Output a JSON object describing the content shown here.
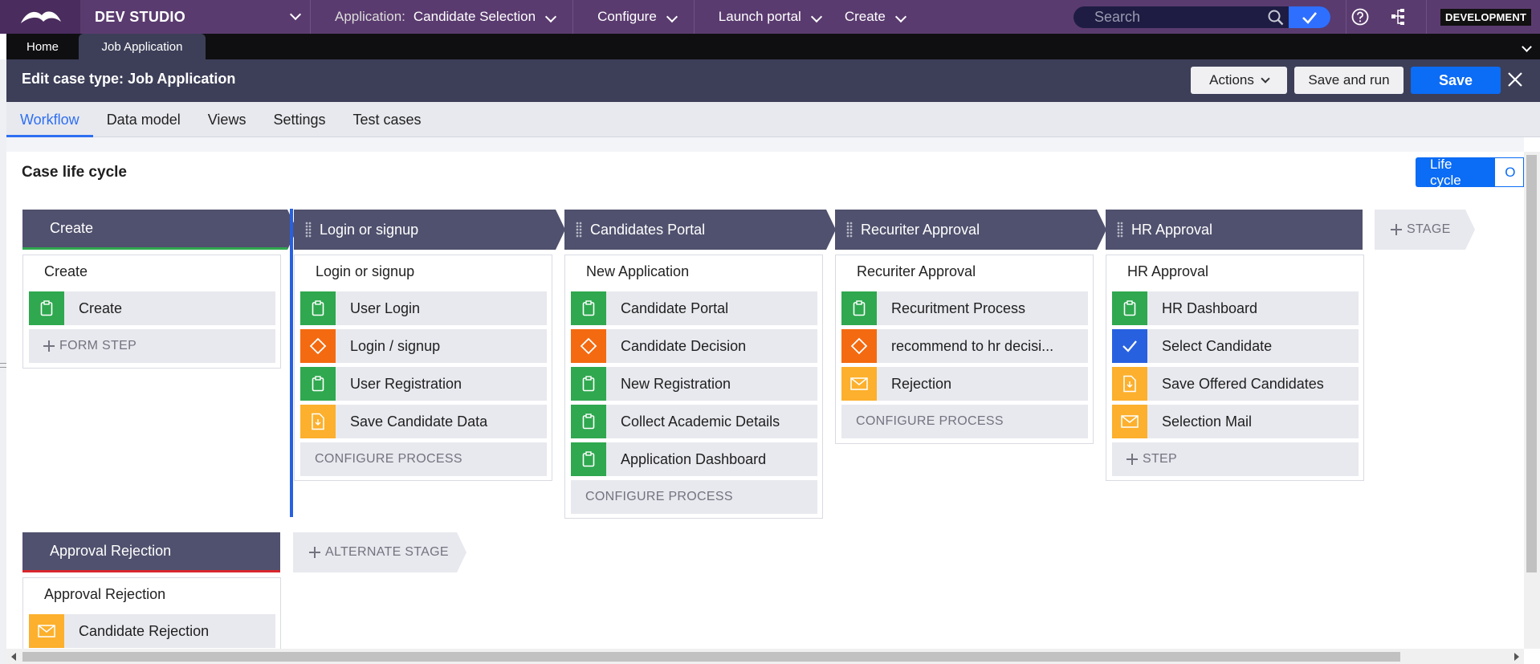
{
  "topbar": {
    "brand": "DEV STUDIO",
    "application_label": "Application:",
    "application_value": "Candidate Selection",
    "configure": "Configure",
    "launch_portal": "Launch portal",
    "create": "Create",
    "search_placeholder": "Search",
    "environment": "DEVELOPMENT",
    "icons": [
      "pega-logo-icon",
      "chevron-down-icon",
      "search-icon",
      "check-icon",
      "help-icon",
      "sitemap-icon"
    ]
  },
  "doc_tabs": [
    {
      "label": "Home",
      "active": false
    },
    {
      "label": "Job Application",
      "active": true
    }
  ],
  "case_header": {
    "prefix": "Edit case type:",
    "name": "Job Application",
    "actions_label": "Actions",
    "save_and_run_label": "Save and run",
    "save_label": "Save"
  },
  "sub_tabs": [
    {
      "label": "Workflow",
      "active": true
    },
    {
      "label": "Data model",
      "active": false
    },
    {
      "label": "Views",
      "active": false
    },
    {
      "label": "Settings",
      "active": false
    },
    {
      "label": "Test cases",
      "active": false
    }
  ],
  "section_title": "Case life cycle",
  "view_toggle": {
    "active": "Life cycle",
    "other": "O"
  },
  "stages": [
    {
      "name": "Create",
      "process": "Create",
      "steps": [
        {
          "type": "form",
          "label": "Create"
        }
      ],
      "add_label": "FORM STEP"
    },
    {
      "name": "Login or signup",
      "process": "Login or signup",
      "steps": [
        {
          "type": "form",
          "label": "User Login"
        },
        {
          "type": "decision",
          "label": "Login / signup"
        },
        {
          "type": "form",
          "label": "User Registration"
        },
        {
          "type": "save",
          "label": "Save Candidate Data"
        }
      ],
      "add_label": "CONFIGURE PROCESS"
    },
    {
      "name": "Candidates Portal",
      "process": "New Application",
      "steps": [
        {
          "type": "form",
          "label": "Candidate Portal"
        },
        {
          "type": "decision",
          "label": "Candidate Decision"
        },
        {
          "type": "form",
          "label": "New Registration"
        },
        {
          "type": "form",
          "label": "Collect Academic Details"
        },
        {
          "type": "form",
          "label": "Application Dashboard"
        }
      ],
      "add_label": "CONFIGURE PROCESS"
    },
    {
      "name": "Recuriter Approval",
      "process": "Recuriter Approval",
      "steps": [
        {
          "type": "form",
          "label": "Recuritment Process"
        },
        {
          "type": "decision",
          "label": "recommend to hr decisi..."
        },
        {
          "type": "email",
          "label": "Rejection"
        }
      ],
      "add_label": "CONFIGURE PROCESS"
    },
    {
      "name": "HR Approval",
      "process": "HR Approval",
      "steps": [
        {
          "type": "form",
          "label": "HR Dashboard"
        },
        {
          "type": "approval",
          "label": "Select Candidate"
        },
        {
          "type": "save",
          "label": "Save Offered Candidates"
        },
        {
          "type": "email",
          "label": "Selection Mail"
        }
      ],
      "add_label": "STEP"
    }
  ],
  "add_stage_label": "STAGE",
  "alternate_stage": {
    "name": "Approval Rejection",
    "process": "Approval Rejection",
    "steps": [
      {
        "type": "email",
        "label": "Candidate Rejection"
      }
    ]
  },
  "add_alternate_stage_label": "ALTERNATE STAGE",
  "colors": {
    "topbar": "#5a3b6f",
    "header": "#3d3f58",
    "stage": "#50516e",
    "primary": "#0b6cf5",
    "form_step": "#2fa84f",
    "decision_step": "#f46a11",
    "save_step": "#fcb02d",
    "approval_step": "#2861e0"
  }
}
